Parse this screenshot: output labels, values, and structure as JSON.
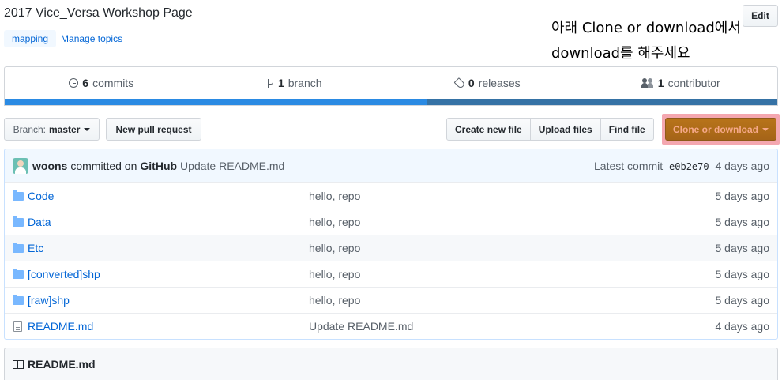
{
  "repo": {
    "description": "2017 Vice_Versa Workshop Page",
    "edit_label": "Edit",
    "topics": [
      "mapping"
    ],
    "manage_topics_label": "Manage topics"
  },
  "annotation": {
    "line1": "아래 Clone or download에서",
    "line2": "download를 해주세요"
  },
  "summary": {
    "commits_count": "6",
    "commits_label": "commits",
    "branch_count": "1",
    "branch_label": "branch",
    "releases_count": "0",
    "releases_label": "releases",
    "contributor_count": "1",
    "contributor_label": "contributor",
    "colors": {
      "lang1": "#2a8ae3",
      "lang2": "#3572a5"
    }
  },
  "toolbar": {
    "branch_prefix": "Branch:",
    "branch_name": "master",
    "new_pr_label": "New pull request",
    "create_file_label": "Create new file",
    "upload_files_label": "Upload files",
    "find_file_label": "Find file",
    "clone_label": "Clone or download"
  },
  "latest_commit": {
    "author": "woons",
    "committed_on_label": "committed on",
    "platform": "GitHub",
    "message": "Update README.md",
    "latest_label": "Latest commit",
    "sha": "e0b2e70",
    "age": "4 days ago"
  },
  "files": [
    {
      "name": "Code",
      "type": "folder",
      "message": "hello, repo",
      "age": "5 days ago"
    },
    {
      "name": "Data",
      "type": "folder",
      "message": "hello, repo",
      "age": "5 days ago"
    },
    {
      "name": "Etc",
      "type": "folder",
      "message": "hello, repo",
      "age": "5 days ago"
    },
    {
      "name": "[converted]shp",
      "type": "folder",
      "message": "hello, repo",
      "age": "5 days ago"
    },
    {
      "name": "[raw]shp",
      "type": "folder",
      "message": "hello, repo",
      "age": "5 days ago"
    },
    {
      "name": "README.md",
      "type": "file",
      "message": "Update README.md",
      "age": "4 days ago"
    }
  ],
  "readme": {
    "title": "README.md"
  }
}
